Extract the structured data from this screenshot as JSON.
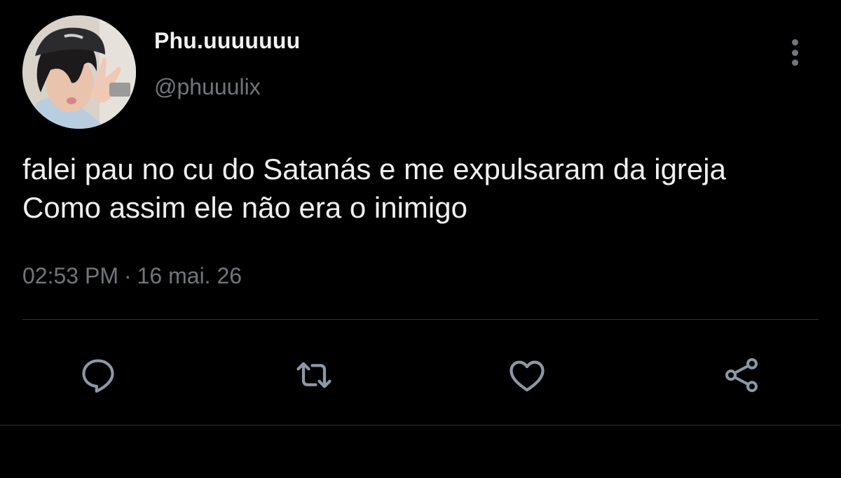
{
  "tweet": {
    "author": {
      "display_name": "Phu.uuuuuuu",
      "handle": "@phuuulix"
    },
    "text": "falei pau no cu do Satanás e me expulsaram da igreja Como assim ele não era o inimigo",
    "time": "02:53 PM",
    "separator": "·",
    "date": "16 mai. 26"
  },
  "icons": {
    "more": "more-vertical-icon",
    "reply": "reply-icon",
    "retweet": "retweet-icon",
    "like": "heart-icon",
    "share": "share-icon"
  },
  "colors": {
    "background": "#000000",
    "text": "#f0f0f0",
    "muted": "#71767b",
    "icon": "#8b98a5",
    "divider": "#2f3336"
  }
}
